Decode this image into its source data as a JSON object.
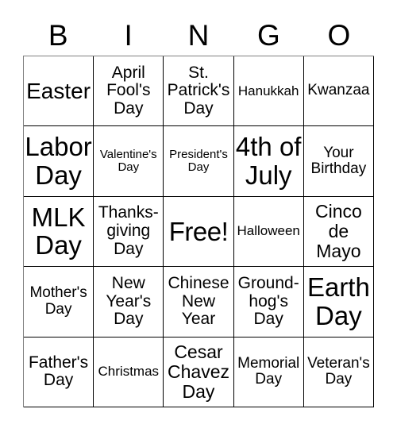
{
  "card": {
    "title": "BINGO",
    "header_letters": [
      "B",
      "I",
      "N",
      "G",
      "O"
    ],
    "colors": {
      "background": "#ffffff",
      "text": "#000000",
      "grid_line": "#000000"
    },
    "grid": {
      "columns": 5,
      "rows": 5,
      "free_space": "Free!"
    },
    "cells": [
      {
        "label": "Easter",
        "size": "xl",
        "column": "B",
        "row": 1
      },
      {
        "label": "April\nFool's\nDay",
        "size": "ml",
        "column": "I",
        "row": 1
      },
      {
        "label": "St.\nPatrick's\nDay",
        "size": "ml",
        "column": "N",
        "row": 1
      },
      {
        "label": "Hanukkah",
        "size": "s",
        "column": "G",
        "row": 1
      },
      {
        "label": "Kwanzaa",
        "size": "m",
        "column": "O",
        "row": 1
      },
      {
        "label": "Labor\nDay",
        "size": "xxl",
        "column": "B",
        "row": 2
      },
      {
        "label": "Valentine's\nDay",
        "size": "xs",
        "column": "I",
        "row": 2
      },
      {
        "label": "President's\nDay",
        "size": "xs",
        "column": "N",
        "row": 2
      },
      {
        "label": "4th of\nJuly",
        "size": "xxl",
        "column": "G",
        "row": 2
      },
      {
        "label": "Your\nBirthday",
        "size": "m",
        "column": "O",
        "row": 2
      },
      {
        "label": "MLK\nDay",
        "size": "xxl",
        "column": "B",
        "row": 3
      },
      {
        "label": "Thanks-\ngiving\nDay",
        "size": "ml",
        "column": "I",
        "row": 3
      },
      {
        "label": "Free!",
        "size": "xxl",
        "column": "N",
        "row": 3
      },
      {
        "label": "Halloween",
        "size": "s",
        "column": "G",
        "row": 3
      },
      {
        "label": "Cinco\nde\nMayo",
        "size": "l",
        "column": "O",
        "row": 3
      },
      {
        "label": "Mother's\nDay",
        "size": "m",
        "column": "B",
        "row": 4
      },
      {
        "label": "New\nYear's\nDay",
        "size": "ml",
        "column": "I",
        "row": 4
      },
      {
        "label": "Chinese\nNew\nYear",
        "size": "ml",
        "column": "N",
        "row": 4
      },
      {
        "label": "Ground-\nhog's\nDay",
        "size": "ml",
        "column": "G",
        "row": 4
      },
      {
        "label": "Earth\nDay",
        "size": "xxl",
        "column": "O",
        "row": 4
      },
      {
        "label": "Father's\nDay",
        "size": "ml",
        "column": "B",
        "row": 5
      },
      {
        "label": "Christmas",
        "size": "s",
        "column": "I",
        "row": 5
      },
      {
        "label": "Cesar\nChavez\nDay",
        "size": "l",
        "column": "N",
        "row": 5
      },
      {
        "label": "Memorial\nDay",
        "size": "m",
        "column": "G",
        "row": 5
      },
      {
        "label": "Veteran's\nDay",
        "size": "m",
        "column": "O",
        "row": 5
      }
    ]
  }
}
